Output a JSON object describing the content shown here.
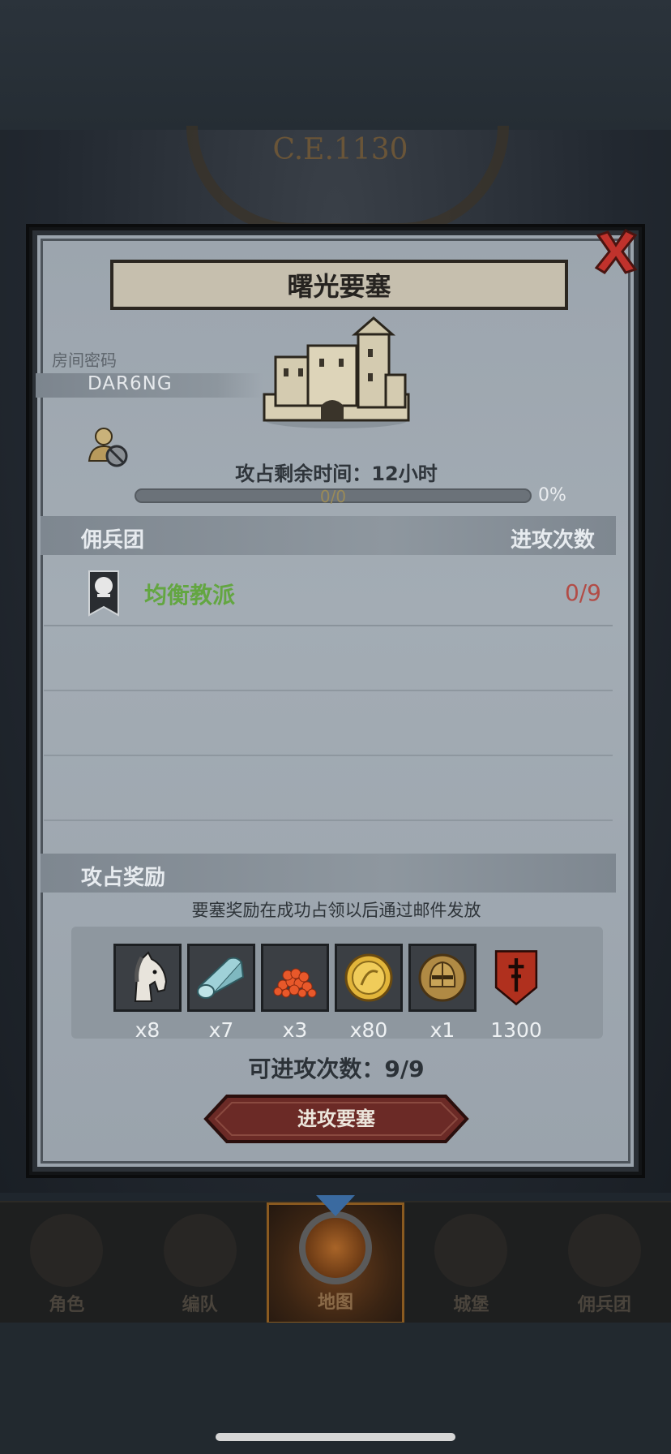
{
  "background": {
    "era_label": "C.E.1130"
  },
  "dialog": {
    "title": "曙光要塞",
    "room_code_label": "房间密码",
    "room_code": "DAR6NG",
    "time_remaining": "攻占剩余时间：12小时",
    "progress": {
      "text": "0/0",
      "percent_label": "0%",
      "fraction": 0
    },
    "mercenary_header": "佣兵团",
    "attack_count_header": "进攻次数",
    "mercenaries": [
      {
        "name": "均衡教派",
        "count": "0/9"
      }
    ],
    "rewards_header": "攻占奖励",
    "rewards_note": "要塞奖励在成功占领以后通过邮件发放",
    "rewards": [
      {
        "icon": "horse-icon",
        "qty": "x8"
      },
      {
        "icon": "cloth-roll-icon",
        "qty": "x7"
      },
      {
        "icon": "roe-icon",
        "qty": "x3"
      },
      {
        "icon": "gold-coin-icon",
        "qty": "x80"
      },
      {
        "icon": "knight-helmet-icon",
        "qty": "x1"
      },
      {
        "icon": "guild-emblem-icon",
        "qty": "1300"
      }
    ],
    "attempts": "可进攻次数：9/9",
    "attack_button": "进攻要塞"
  },
  "nav": [
    {
      "label": "角色",
      "icon": "character-icon",
      "active": false
    },
    {
      "label": "编队",
      "icon": "formation-icon",
      "active": false
    },
    {
      "label": "地图",
      "icon": "map-icon",
      "active": true
    },
    {
      "label": "城堡",
      "icon": "castle-icon",
      "active": false
    },
    {
      "label": "佣兵团",
      "icon": "mercenary-icon",
      "active": false
    }
  ],
  "colors": {
    "accent_green": "#63a641",
    "count_red": "#b24c46",
    "close_red": "#c0322c",
    "button_red": "#6b2a26"
  }
}
